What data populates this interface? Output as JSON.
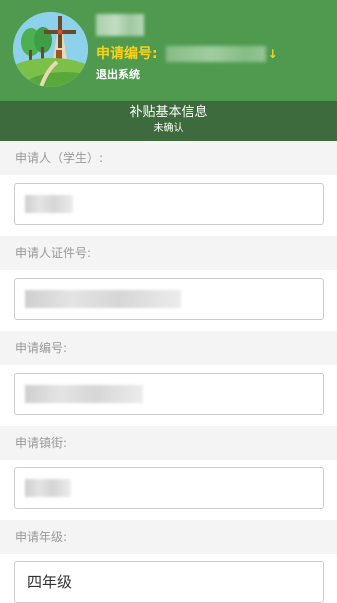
{
  "header": {
    "application_number_label": "申请编号:",
    "logout_label": "退出系统",
    "colors": {
      "header_bg": "#4f9a4f",
      "accent": "#f8d11a",
      "section_bg": "#3d6b3d"
    }
  },
  "section": {
    "title": "补贴基本信息",
    "status": "未确认"
  },
  "form": {
    "fields": [
      {
        "label": "申请人（学生）:",
        "value": null
      },
      {
        "label": "申请人证件号:",
        "value": null
      },
      {
        "label": "申请编号:",
        "value": null
      },
      {
        "label": "申请镇街:",
        "value": null
      },
      {
        "label": "申请年级:",
        "value": "四年级"
      }
    ]
  }
}
